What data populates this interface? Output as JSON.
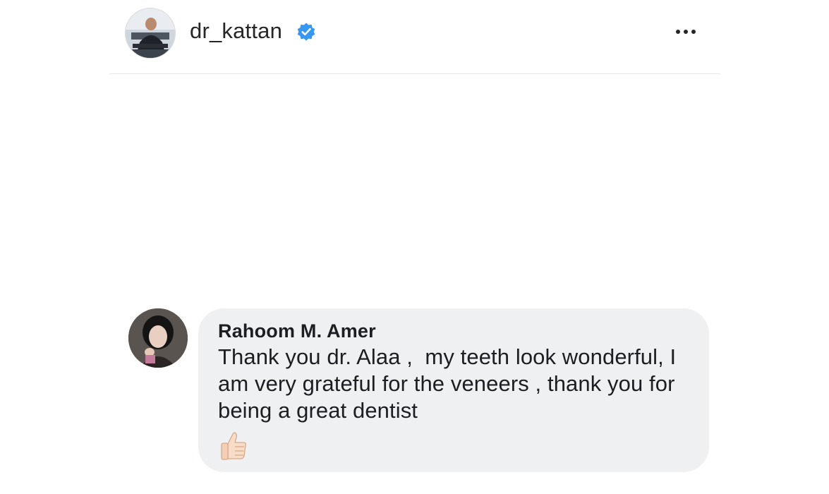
{
  "post_header": {
    "username": "dr_kattan",
    "verified_icon": "verified-badge-icon",
    "more_icon": "more-options-icon",
    "accent_color": "#3897f0"
  },
  "comment": {
    "author": "Rahoom M. Amer",
    "text": "Thank you dr. Alaa ,  my teeth look wonderful, I am very grateful for the veneers , thank you for being a great dentist",
    "emoji": "👍",
    "emoji_icon": "thumbs-up-icon",
    "bubble_color": "#eff0f2"
  }
}
